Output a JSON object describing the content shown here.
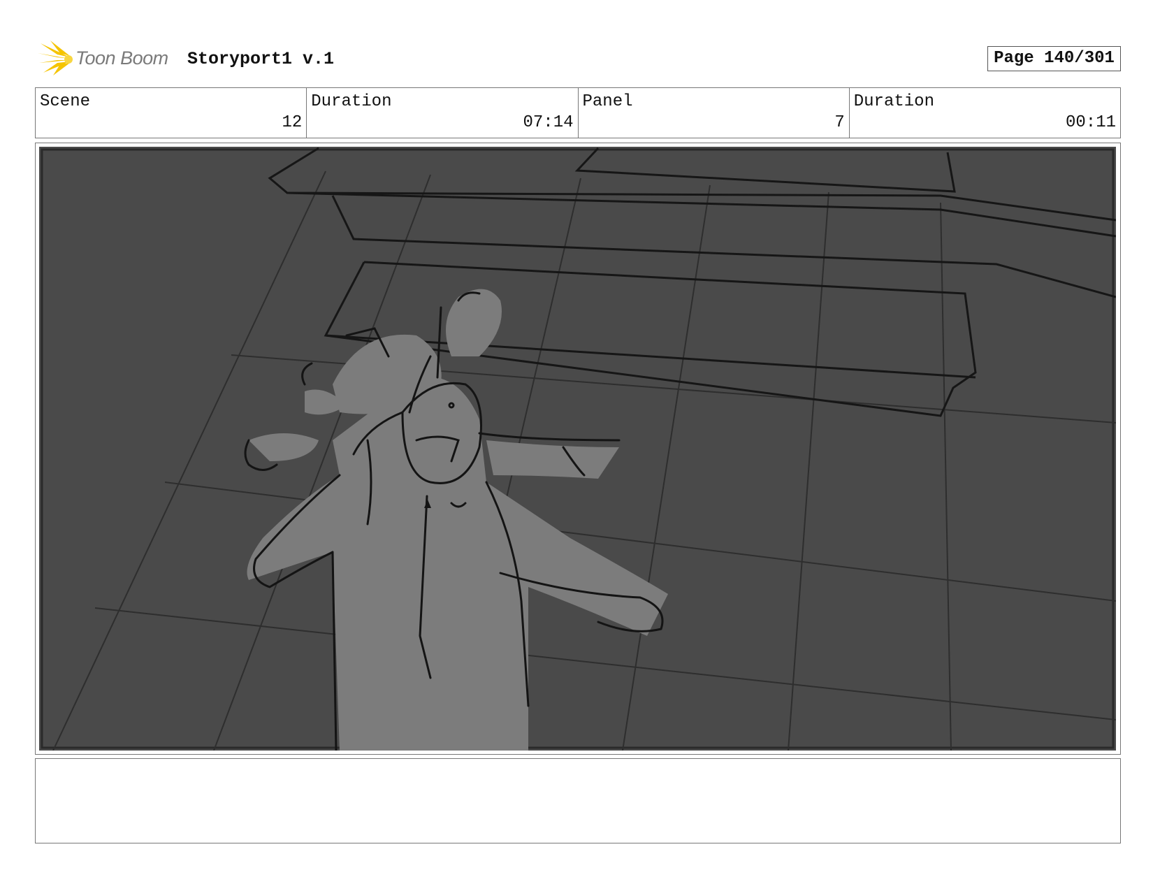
{
  "header": {
    "logo_text": "Toon Boom",
    "project_title": "Storyport1 v.1",
    "page_label": "Page 140/301"
  },
  "info": {
    "scene_label": "Scene",
    "scene_value": "12",
    "scene_duration_label": "Duration",
    "scene_duration_value": "07:14",
    "panel_label": "Panel",
    "panel_value": "7",
    "panel_duration_label": "Duration",
    "panel_duration_value": "00:11"
  },
  "notes": {
    "text": ""
  },
  "colors": {
    "logo_accent": "#f5c400",
    "panel_background": "#4a4a4a",
    "figure_fill": "#7c7c7c"
  }
}
